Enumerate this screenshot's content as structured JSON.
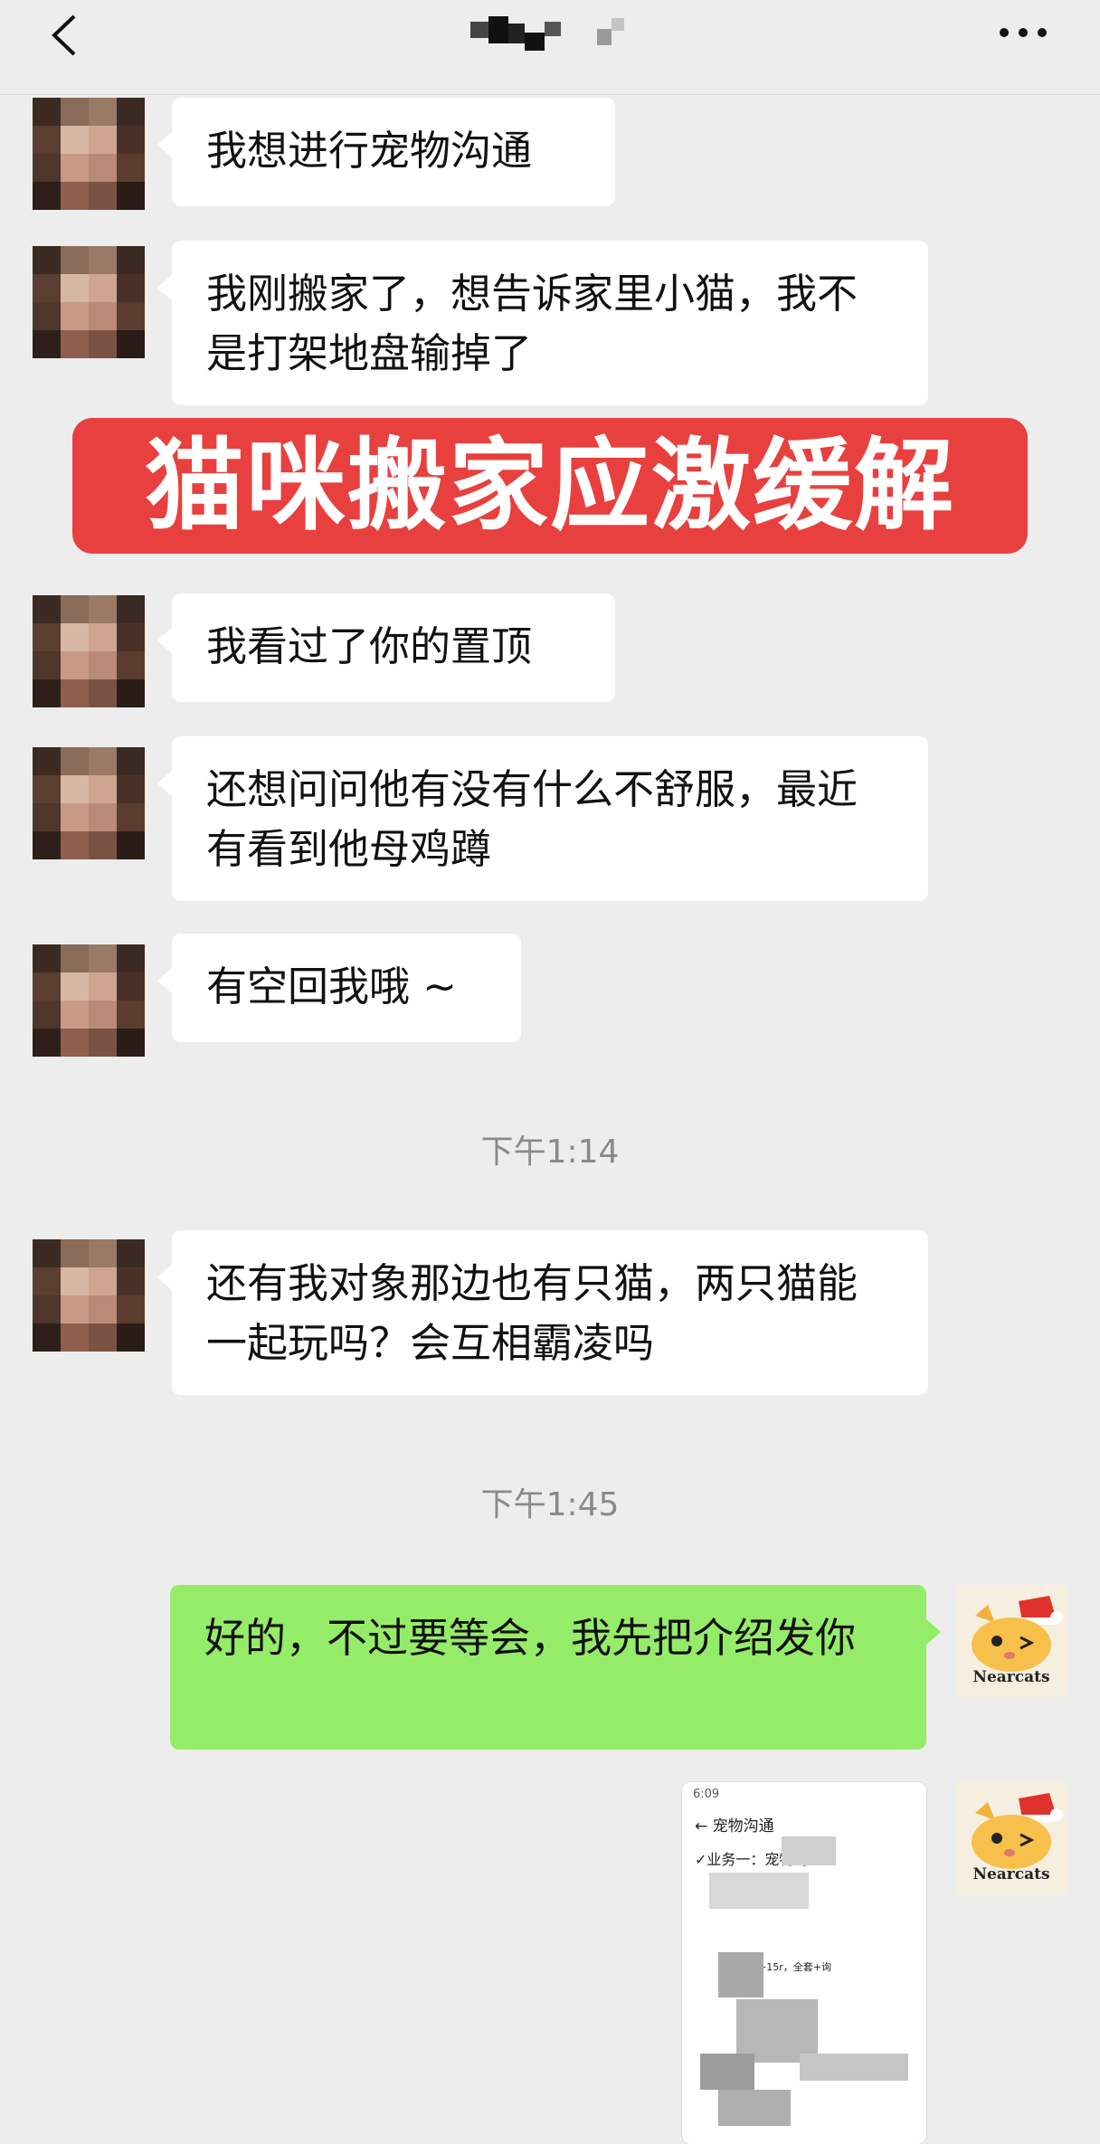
{
  "header": {
    "back_icon": "chevron-left-icon",
    "more_icon": "ellipsis-icon"
  },
  "messages": [
    {
      "from": "contact",
      "text": "我想进行宠物沟通"
    },
    {
      "from": "contact",
      "text": "我刚搬家了，想告诉家里小猫，我不是打架地盘输掉了"
    },
    {
      "from": "contact",
      "text": "我看过了你的置顶"
    },
    {
      "from": "contact",
      "text": "还想问问他有没有什么不舒服，最近有看到他母鸡蹲"
    },
    {
      "from": "contact",
      "text": "有空回我哦 ~"
    },
    {
      "from": "contact",
      "text": "还有我对象那边也有只猫，两只猫能一起玩吗？会互相霸凌吗"
    },
    {
      "from": "me",
      "text": "好的，不过要等会，我先把介绍发你"
    }
  ],
  "timestamps": [
    "下午1:14",
    "下午1:45"
  ],
  "banner": {
    "text": "猫咪搬家应激缓解",
    "color": "#e8403e"
  },
  "my_avatar": {
    "watermark": "Nearcats"
  },
  "screenshot_message": {
    "status": "6:09",
    "header": "← 宠物沟通",
    "line1": "✓业务一：宠物沟通",
    "line2": "一个问题+15r，全套+询"
  },
  "colors": {
    "my_bubble": "#95ec69",
    "contact_bubble": "#ffffff",
    "background": "#ededed"
  }
}
